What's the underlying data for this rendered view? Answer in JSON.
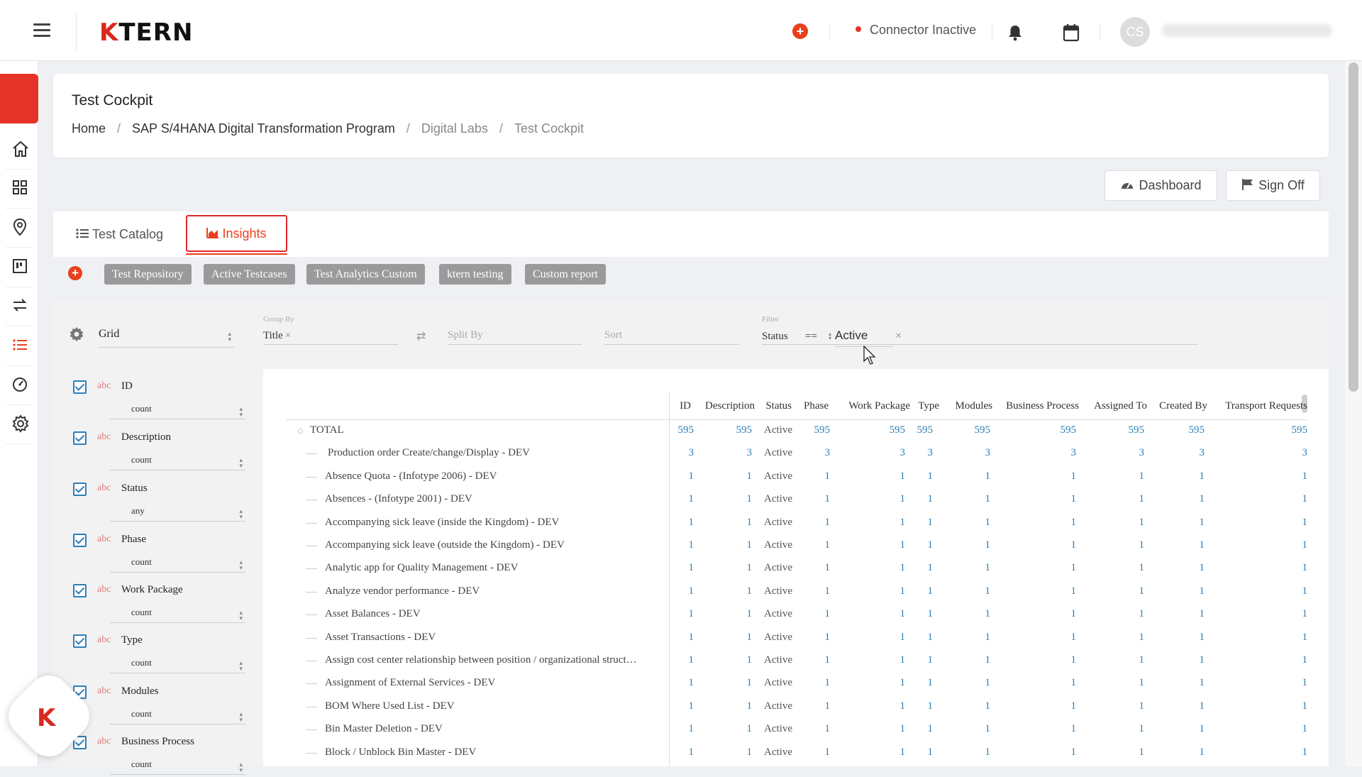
{
  "header": {
    "logo_k": "K",
    "logo_rest": "TERN",
    "connector_status": "Connector Inactive",
    "avatar_initials": "CS"
  },
  "page": {
    "title": "Test Cockpit",
    "breadcrumb": [
      "Home",
      "SAP S/4HANA Digital Transformation Program",
      "Digital Labs",
      "Test Cockpit"
    ]
  },
  "actions": {
    "dashboard": "Dashboard",
    "sign_off": "Sign Off"
  },
  "tabs": {
    "catalog": "Test Catalog",
    "insights": "Insights"
  },
  "reports": [
    "Test Repository",
    "Active Testcases",
    "Test Analytics Custom",
    "ktern testing",
    "Custom report"
  ],
  "pivot": {
    "renderer": "Grid",
    "group_by_label": "Group By",
    "group_by_value": "Title",
    "split_by_placeholder": "Split By",
    "sort_placeholder": "Sort",
    "filter_label": "Filter",
    "filter_field": "Status",
    "filter_op": "==",
    "filter_value": "Active",
    "attributes": [
      {
        "type": "abc",
        "name": "ID",
        "agg": "count"
      },
      {
        "type": "abc",
        "name": "Description",
        "agg": "count"
      },
      {
        "type": "abc",
        "name": "Status",
        "agg": "any"
      },
      {
        "type": "abc",
        "name": "Phase",
        "agg": "count"
      },
      {
        "type": "abc",
        "name": "Work Package",
        "agg": "count"
      },
      {
        "type": "abc",
        "name": "Type",
        "agg": "count"
      },
      {
        "type": "abc",
        "name": "Modules",
        "agg": "count"
      },
      {
        "type": "abc",
        "name": "Business Process",
        "agg": "count"
      }
    ]
  },
  "table": {
    "columns": [
      "ID",
      "Description",
      "Status",
      "Phase",
      "Work Package",
      "Type",
      "Modules",
      "Business Process",
      "Assigned To",
      "Created By",
      "Transport Requests"
    ],
    "total": {
      "label": "TOTAL",
      "values": [
        "595",
        "595",
        "Active",
        "595",
        "595",
        "595",
        "595",
        "595",
        "595",
        "595",
        "595"
      ]
    },
    "rows": [
      {
        "label": "Production order Create/change/Display - DEV",
        "values": [
          "3",
          "3",
          "Active",
          "3",
          "3",
          "3",
          "3",
          "3",
          "3",
          "3",
          "3"
        ]
      },
      {
        "label": "Absence Quota - (Infotype 2006) - DEV",
        "values": [
          "1",
          "1",
          "Active",
          "1",
          "1",
          "1",
          "1",
          "1",
          "1",
          "1",
          "1"
        ]
      },
      {
        "label": "Absences - (Infotype 2001) - DEV",
        "values": [
          "1",
          "1",
          "Active",
          "1",
          "1",
          "1",
          "1",
          "1",
          "1",
          "1",
          "1"
        ]
      },
      {
        "label": "Accompanying sick leave (inside the Kingdom) - DEV",
        "values": [
          "1",
          "1",
          "Active",
          "1",
          "1",
          "1",
          "1",
          "1",
          "1",
          "1",
          "1"
        ]
      },
      {
        "label": "Accompanying sick leave (outside the Kingdom) - DEV",
        "values": [
          "1",
          "1",
          "Active",
          "1",
          "1",
          "1",
          "1",
          "1",
          "1",
          "1",
          "1"
        ]
      },
      {
        "label": "Analytic app for Quality Management - DEV",
        "values": [
          "1",
          "1",
          "Active",
          "1",
          "1",
          "1",
          "1",
          "1",
          "1",
          "1",
          "1"
        ]
      },
      {
        "label": "Analyze vendor performance - DEV",
        "values": [
          "1",
          "1",
          "Active",
          "1",
          "1",
          "1",
          "1",
          "1",
          "1",
          "1",
          "1"
        ]
      },
      {
        "label": "Asset Balances - DEV",
        "values": [
          "1",
          "1",
          "Active",
          "1",
          "1",
          "1",
          "1",
          "1",
          "1",
          "1",
          "1"
        ]
      },
      {
        "label": "Asset Transactions - DEV",
        "values": [
          "1",
          "1",
          "Active",
          "1",
          "1",
          "1",
          "1",
          "1",
          "1",
          "1",
          "1"
        ]
      },
      {
        "label": "Assign  cost center relationship between position / organizational struct…",
        "values": [
          "1",
          "1",
          "Active",
          "1",
          "1",
          "1",
          "1",
          "1",
          "1",
          "1",
          "1"
        ]
      },
      {
        "label": "Assignment of External Services - DEV",
        "values": [
          "1",
          "1",
          "Active",
          "1",
          "1",
          "1",
          "1",
          "1",
          "1",
          "1",
          "1"
        ]
      },
      {
        "label": "BOM Where Used List - DEV",
        "values": [
          "1",
          "1",
          "Active",
          "1",
          "1",
          "1",
          "1",
          "1",
          "1",
          "1",
          "1"
        ]
      },
      {
        "label": "Bin Master Deletion - DEV",
        "values": [
          "1",
          "1",
          "Active",
          "1",
          "1",
          "1",
          "1",
          "1",
          "1",
          "1",
          "1"
        ]
      },
      {
        "label": "Block / Unblock Bin Master - DEV",
        "values": [
          "1",
          "1",
          "Active",
          "1",
          "1",
          "1",
          "1",
          "1",
          "1",
          "1",
          "1"
        ]
      }
    ]
  },
  "colors": {
    "accent": "#e8401c",
    "link": "#2d7fb8",
    "chip": "#9a9a9a",
    "rail_accent": "#e5332a"
  }
}
